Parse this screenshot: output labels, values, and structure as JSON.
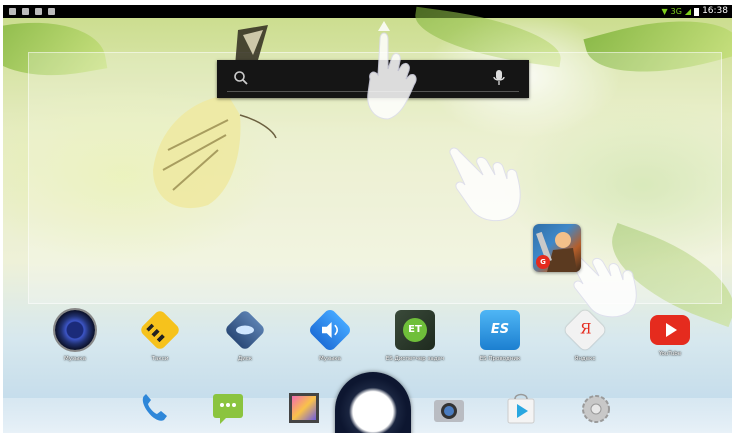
{
  "status_bar": {
    "time": "16:38",
    "network": "3G"
  },
  "search": {
    "placeholder": ""
  },
  "apps": [
    {
      "label": "Музыка",
      "icon": "speaker-icon"
    },
    {
      "label": "Такси",
      "icon": "taxi-icon"
    },
    {
      "label": "Диск",
      "icon": "disk-icon"
    },
    {
      "label": "Музыка",
      "icon": "sound-icon"
    },
    {
      "label": "ES Диспетчер задач",
      "icon": "es-task-manager-icon"
    },
    {
      "label": "ES Проводник",
      "icon": "es-explorer-icon"
    },
    {
      "label": "Яндекс",
      "icon": "yandex-icon"
    },
    {
      "label": "YouTube",
      "icon": "youtube-icon"
    }
  ],
  "game_widget": {
    "badge": "G"
  },
  "dock": [
    {
      "icon": "phone-icon"
    },
    {
      "icon": "messaging-icon"
    },
    {
      "icon": "gallery-icon"
    },
    {
      "icon": "all-apps-icon"
    },
    {
      "icon": "camera-icon"
    },
    {
      "icon": "play-store-icon"
    },
    {
      "icon": "settings-icon"
    }
  ],
  "colors": {
    "status_bar": "#000000",
    "signal_green": "#7fd11e",
    "youtube_red": "#e52b1e"
  }
}
